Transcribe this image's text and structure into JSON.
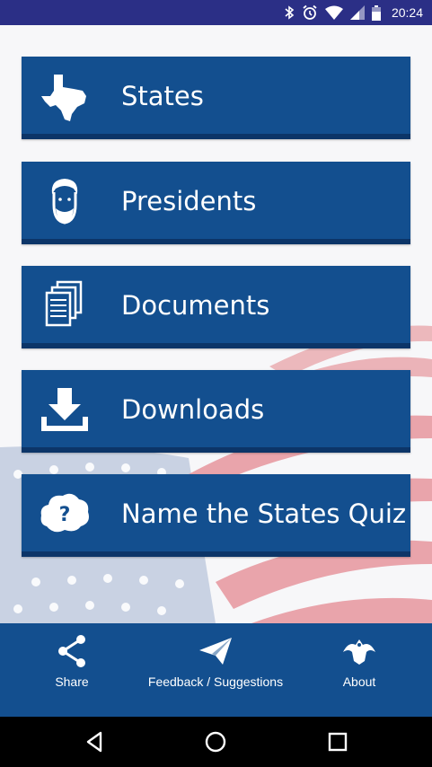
{
  "status_bar": {
    "time": "20:24",
    "background": "#2b2f86",
    "icons": [
      "bluetooth-icon",
      "alarm-icon",
      "wifi-icon",
      "signal-icon",
      "battery-icon"
    ]
  },
  "menu": {
    "items": [
      {
        "label": "States",
        "icon": "texas-state-icon"
      },
      {
        "label": "Presidents",
        "icon": "president-face-icon"
      },
      {
        "label": "Documents",
        "icon": "documents-icon"
      },
      {
        "label": "Downloads",
        "icon": "download-icon"
      },
      {
        "label": "Name the States Quiz",
        "icon": "question-cloud-icon"
      }
    ],
    "button_color": "#134f8f"
  },
  "bottom_nav": {
    "items": [
      {
        "label": "Share",
        "icon": "share-icon"
      },
      {
        "label": "Feedback / Suggestions",
        "icon": "paper-plane-icon"
      },
      {
        "label": "About",
        "icon": "eagle-icon"
      }
    ]
  },
  "system_nav": {
    "buttons": [
      "back-icon",
      "home-icon",
      "recents-icon"
    ]
  }
}
